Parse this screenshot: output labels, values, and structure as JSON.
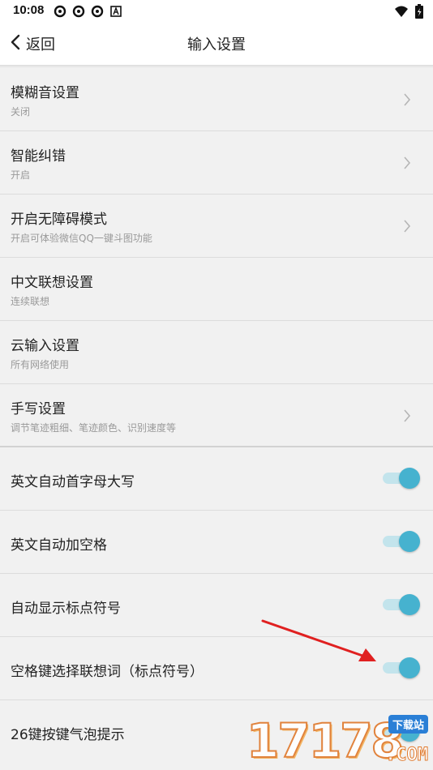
{
  "status_bar": {
    "time": "10:08",
    "left_icons": [
      "sync-icon",
      "sync-icon",
      "sync-icon",
      "a-notification-icon"
    ],
    "right_icons": [
      "wifi-icon",
      "battery-icon"
    ]
  },
  "header": {
    "back_label": "返回",
    "title": "输入设置"
  },
  "nav_rows": [
    {
      "title": "模糊音设置",
      "subtitle": "关闭",
      "chevron": true
    },
    {
      "title": "智能纠错",
      "subtitle": "开启",
      "chevron": true
    },
    {
      "title": "开启无障碍模式",
      "subtitle": "开启可体验微信QQ一键斗图功能",
      "chevron": true
    },
    {
      "title": "中文联想设置",
      "subtitle": "连续联想",
      "chevron": false
    },
    {
      "title": "云输入设置",
      "subtitle": "所有网络使用",
      "chevron": false
    },
    {
      "title": "手写设置",
      "subtitle": "调节笔迹粗细、笔迹颜色、识别速度等",
      "chevron": true
    }
  ],
  "toggle_rows": [
    {
      "title": "英文自动首字母大写",
      "on": true
    },
    {
      "title": "英文自动加空格",
      "on": true
    },
    {
      "title": "自动显示标点符号",
      "on": true
    },
    {
      "title": "空格键选择联想词（标点符号）",
      "on": true
    },
    {
      "title": "26键按键气泡提示",
      "on": true
    }
  ],
  "colors": {
    "accent": "#46b2cf",
    "track": "#c3e4ec",
    "annotation_arrow": "#e02020"
  },
  "watermark": {
    "digits": "17178",
    "tag": "下载站",
    "domain": ".COM"
  }
}
